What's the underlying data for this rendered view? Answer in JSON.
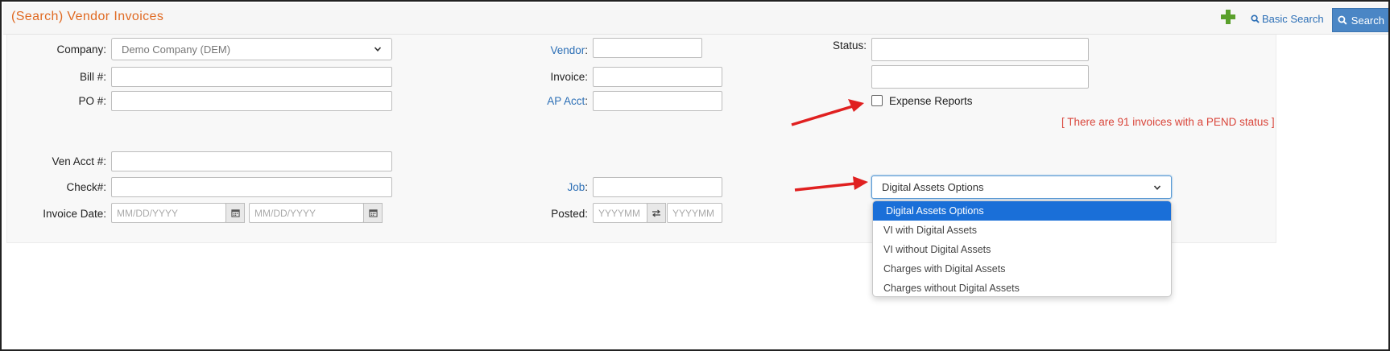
{
  "header": {
    "title": "(Search) Vendor Invoices",
    "basic_search_label": "Basic Search",
    "search_label": "Search"
  },
  "form": {
    "company": {
      "label": "Company:",
      "value": "Demo Company (DEM)"
    },
    "bill": {
      "label": "Bill #:",
      "value": ""
    },
    "po": {
      "label": "PO #:",
      "value": ""
    },
    "ven_acct": {
      "label": "Ven Acct #:",
      "value": ""
    },
    "check": {
      "label": "Check#:",
      "value": ""
    },
    "invoice_date": {
      "label": "Invoice Date:",
      "from_placeholder": "MM/DD/YYYY",
      "to_placeholder": "MM/DD/YYYY"
    },
    "vendor": {
      "label": "Vendor",
      "colon": ":",
      "value": ""
    },
    "invoice": {
      "label": "Invoice:",
      "value": ""
    },
    "ap_acct": {
      "label": "AP Acct",
      "colon": ":",
      "value": ""
    },
    "job": {
      "label": "Job",
      "colon": ":",
      "value": ""
    },
    "posted": {
      "label": "Posted:",
      "from_placeholder": "YYYYMM",
      "to_placeholder": "YYYYMM"
    },
    "status": {
      "label": "Status:",
      "value": ""
    },
    "expense_reports": {
      "label": "Expense Reports",
      "checked": false
    },
    "pend_note": "[ There are 91 invoices with a PEND status ]",
    "digital_assets": {
      "selected": "Digital Assets Options",
      "options": [
        "Digital Assets Options",
        "VI with Digital Assets",
        "VI without Digital Assets",
        "Charges with Digital Assets",
        "Charges without Digital Assets"
      ]
    }
  },
  "colors": {
    "title": "#e06a23",
    "link": "#2c6fb6",
    "search_button": "#4a86c5",
    "option_highlight": "#1a6fd8",
    "annotation_arrow": "#e02020",
    "pend_note": "#d9453a",
    "plus_icon": "#5aa02c"
  },
  "icons": {
    "add": "plus-icon",
    "basic_search": "search-icon",
    "search_button": "search-icon",
    "date_picker": "calendar-icon",
    "posted_swap": "swap-arrows-icon",
    "select": "chevron-down-icon",
    "annotation": "red-arrow-icon"
  }
}
